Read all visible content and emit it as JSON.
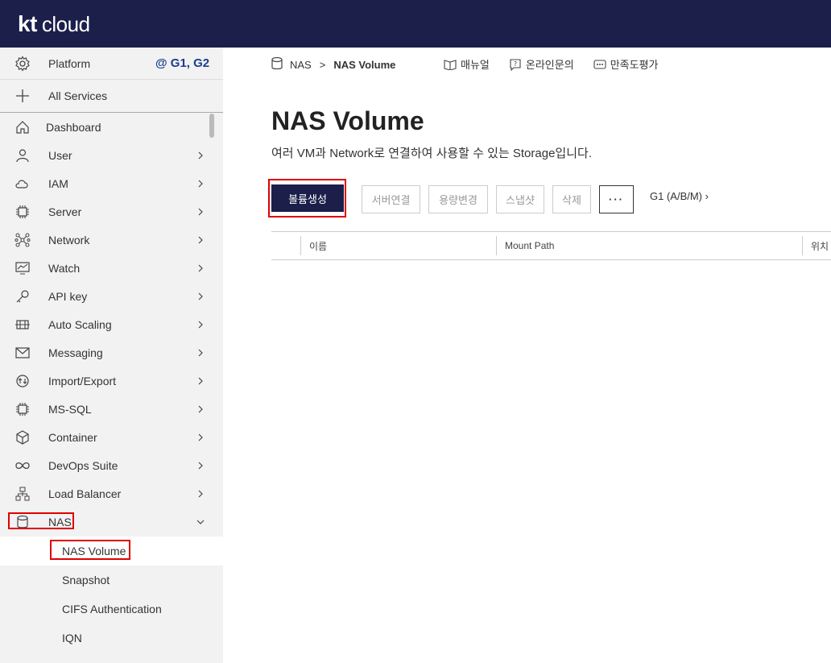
{
  "header": {
    "logo_kt": "kt",
    "logo_cloud": "cloud"
  },
  "sidebar": {
    "platform_label": "Platform",
    "region": "@ G1, G2",
    "all_services": "All Services",
    "items": [
      {
        "label": "Dashboard",
        "icon": "home-icon"
      },
      {
        "label": "User",
        "icon": "user-icon"
      },
      {
        "label": "IAM",
        "icon": "cloud-icon"
      },
      {
        "label": "Server",
        "icon": "chip-icon"
      },
      {
        "label": "Network",
        "icon": "network-icon"
      },
      {
        "label": "Watch",
        "icon": "monitor-icon"
      },
      {
        "label": "API key",
        "icon": "key-icon"
      },
      {
        "label": "Auto Scaling",
        "icon": "scaling-icon"
      },
      {
        "label": "Messaging",
        "icon": "mail-icon"
      },
      {
        "label": "Import/Export",
        "icon": "transfer-icon"
      },
      {
        "label": "MS-SQL",
        "icon": "chip-icon"
      },
      {
        "label": "Container",
        "icon": "box-icon"
      },
      {
        "label": "DevOps Suite",
        "icon": "infinity-icon"
      },
      {
        "label": "Load Balancer",
        "icon": "hierarchy-icon"
      },
      {
        "label": "NAS",
        "icon": "database-icon"
      }
    ],
    "nas_sub": [
      "NAS Volume",
      "Snapshot",
      "CIFS Authentication",
      "IQN"
    ]
  },
  "breadcrumb": {
    "parent": "NAS",
    "sep": ">",
    "current": "NAS Volume"
  },
  "toplinks": [
    "매뉴얼",
    "온라인문의",
    "만족도평가"
  ],
  "page": {
    "title": "NAS Volume",
    "description": "여러 VM과 Network로 연결하여 사용할 수 있는 Storage입니다."
  },
  "toolbar": {
    "create": "볼륨생성",
    "attach": "서버연결",
    "resize": "용량변경",
    "snapshot": "스냅샷",
    "delete": "삭제",
    "more": "···",
    "zone": "G1 (A/B/M) ›"
  },
  "table": {
    "columns": [
      "이름",
      "Mount Path",
      "위치"
    ]
  },
  "colors": {
    "navy": "#1b1f4a",
    "highlight": "#e00000",
    "region": "#1b3d8f"
  }
}
